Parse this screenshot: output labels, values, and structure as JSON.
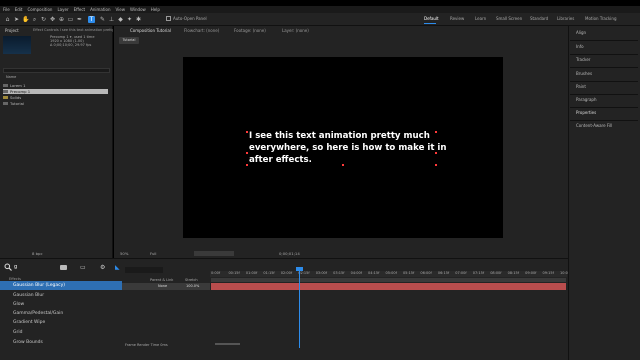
{
  "menu": [
    "File",
    "Edit",
    "Composition",
    "Layer",
    "Effect",
    "Animation",
    "View",
    "Window",
    "Help"
  ],
  "toolbar": {
    "auto_open_label": "Auto-Open Panel"
  },
  "workspaces": [
    "Default",
    "Review",
    "Learn",
    "Small Screen",
    "Standard",
    "Libraries",
    "Motion Tracking"
  ],
  "project": {
    "tab": "Project",
    "effect_controls_tab": "Effect Controls I see this text animation pretty much",
    "info_lines": [
      "Precomp 1 ▾, used 1 time",
      "1920 x 1080 (1.00)",
      "Δ 0;00;10;00, 29.97 fps"
    ],
    "column_name": "Name",
    "items": [
      "Lorem 1",
      "Precomp 1",
      "Solids",
      "Tutorial"
    ],
    "bpc": "8 bpc"
  },
  "effects": {
    "search_value": "g",
    "folder": "Effects",
    "items": [
      "Gaussian Blur (Legacy)",
      "Gaussian Blur",
      "Glow",
      "Gamma/Pedestal/Gain",
      "Gradient Wipe",
      "Grid",
      "Grow Bounds"
    ]
  },
  "composition": {
    "tabs": [
      "Composition Tutorial",
      "Flowchart: (none)",
      "Footage: (none)",
      "Layer: (none)"
    ],
    "crumb": "Tutorial",
    "text": "I see this text animation pretty much everywhere, so here is how to make it in after effects.",
    "zoom": "50%",
    "quality": "Full",
    "timecode": "0;00;01;14"
  },
  "timeline": {
    "ruler": [
      "0:00f",
      "00:15f",
      "01:00f",
      "01:15f",
      "02:00f",
      "02:15f",
      "03:00f",
      "03:15f",
      "04:00f",
      "04:15f",
      "05:00f",
      "05:15f",
      "06:00f",
      "06:15f",
      "07:00f",
      "07:15f",
      "08:00f",
      "08:15f",
      "09:00f",
      "09:15f",
      "10:00"
    ],
    "col_parent": "Parent & Link",
    "col_stretch": "Stretch",
    "parent_value": "None",
    "stretch_value": "100.0%",
    "modes_label": "Frame Render Time 0ms"
  },
  "right_panels": [
    "Align",
    "Info",
    "Tracker",
    "Brushes",
    "Paint",
    "Paragraph",
    "Properties",
    "Content-Aware Fill"
  ],
  "colors": {
    "accent": "#2d8ceb",
    "layer_bar": "#b94d4d",
    "selection": "#2e6fb3"
  }
}
